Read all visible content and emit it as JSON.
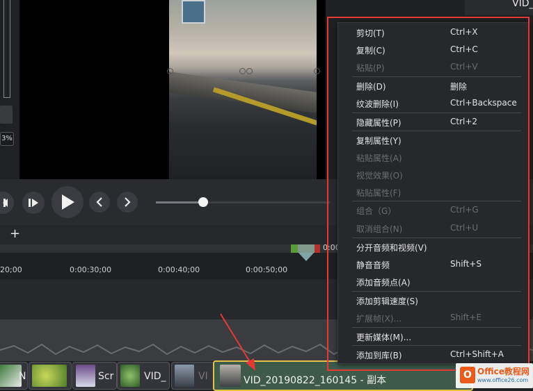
{
  "preview": {
    "zoom_percent": "3%",
    "top_right_clip_label": "VID_"
  },
  "timeline": {
    "add_track": "+",
    "ruler_labels": [
      "20;00",
      "0:00:30;00",
      "0:00:40;00",
      "0:00:50;00",
      "0:00"
    ],
    "clips": [
      {
        "label": "N"
      },
      {
        "label": ""
      },
      {
        "label": "Scr"
      },
      {
        "label": "VID_"
      },
      {
        "label": "VI"
      }
    ],
    "active_clip_label": "VID_20190822_160145 - 副本"
  },
  "context_menu": {
    "items": [
      {
        "label": "剪切(T)",
        "shortcut": "Ctrl+X",
        "enabled": true
      },
      {
        "label": "复制(C)",
        "shortcut": "Ctrl+C",
        "enabled": true
      },
      {
        "label": "粘贴(P)",
        "shortcut": "Ctrl+V",
        "enabled": false
      },
      {
        "label": "删除(D)",
        "shortcut": "删除",
        "enabled": true
      },
      {
        "label": "纹波删除(I)",
        "shortcut": "Ctrl+Backspace",
        "enabled": true
      },
      {
        "label": "隐藏属性(P)",
        "shortcut": "Ctrl+2",
        "enabled": true
      },
      {
        "label": "复制属性(Y)",
        "shortcut": "",
        "enabled": true
      },
      {
        "label": "粘贴属性(A)",
        "shortcut": "",
        "enabled": false
      },
      {
        "label": "视觉效果(O)",
        "shortcut": "",
        "enabled": false
      },
      {
        "label": "粘贴属性(F)",
        "shortcut": "",
        "enabled": false
      },
      {
        "label": "组合（G）",
        "shortcut": "Ctrl+G",
        "enabled": false
      },
      {
        "label": "取消组合(N)",
        "shortcut": "Ctrl+U",
        "enabled": false
      },
      {
        "label": "分开音频和视频(V)",
        "shortcut": "",
        "enabled": true
      },
      {
        "label": "静音音频",
        "shortcut": "Shift+S",
        "enabled": true
      },
      {
        "label": "添加音频点(A)",
        "shortcut": "",
        "enabled": true
      },
      {
        "label": "添加剪辑速度(S)",
        "shortcut": "",
        "enabled": true
      },
      {
        "label": "扩展帧(X)...",
        "shortcut": "Shift+E",
        "enabled": false
      },
      {
        "label": "更新媒体(M)...",
        "shortcut": "",
        "enabled": true
      },
      {
        "label": "添加到库(B)",
        "shortcut": "Ctrl+Shift+A",
        "enabled": true
      }
    ]
  },
  "watermark": {
    "logo_text": "O",
    "line1": "Office教程网",
    "line2": "www.office26.com"
  },
  "colors": {
    "highlight_box": "#e53935",
    "active_clip_border": "#e6c24a",
    "menu_bg": "#27282c"
  }
}
